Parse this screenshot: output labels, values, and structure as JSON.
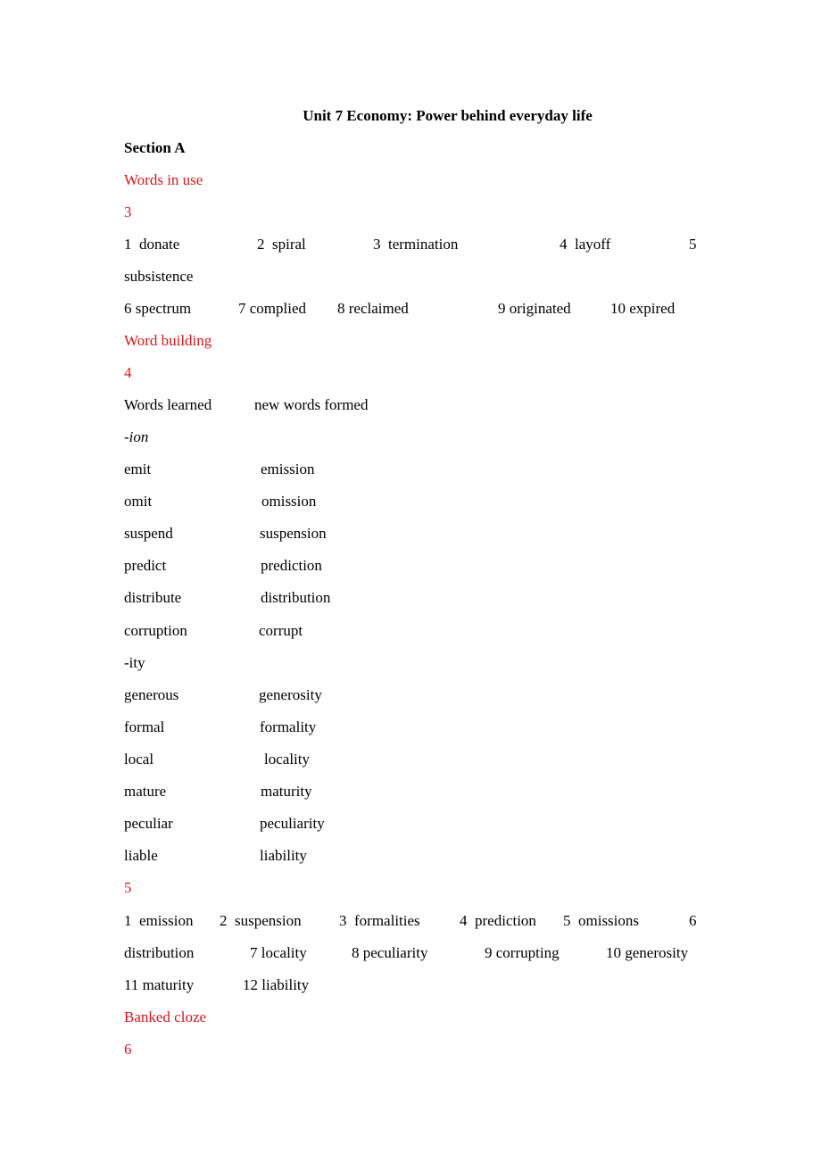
{
  "document": {
    "title": "Unit 7 Economy: Power behind everyday life",
    "section": "Section A",
    "words_in_use": {
      "heading": "Words in use",
      "exercise_number": "3",
      "answers_row1": [
        "1  donate",
        "2  spiral",
        "3  termination",
        "4  layoff",
        "5"
      ],
      "answers_row1_wrap": "subsistence",
      "answers_row2": [
        "6 spectrum",
        "7 complied",
        "8 reclaimed",
        "9 originated",
        "10 expired"
      ]
    },
    "word_building": {
      "heading": "Word building",
      "exercise_number": "4",
      "col_headers": [
        "Words learned",
        "new words formed"
      ],
      "groups": [
        {
          "suffix": "-ion",
          "pairs": [
            [
              "emit",
              "emission"
            ],
            [
              "omit",
              "omission"
            ],
            [
              "suspend",
              "suspension"
            ],
            [
              "predict",
              "prediction"
            ],
            [
              "distribute",
              "distribution"
            ],
            [
              "corruption",
              "corrupt"
            ]
          ]
        },
        {
          "suffix": "-ity",
          "pairs": [
            [
              "generous",
              "generosity"
            ],
            [
              "formal",
              "formality"
            ],
            [
              "local",
              "locality"
            ],
            [
              "mature",
              "maturity"
            ],
            [
              "peculiar",
              "peculiarity"
            ],
            [
              "liable",
              "liability"
            ]
          ]
        }
      ]
    },
    "exercise5": {
      "number": "5",
      "row1": [
        "1  emission",
        "2  suspension",
        "3  formalities",
        "4  prediction",
        "5  omissions",
        "6"
      ],
      "row2": [
        "distribution",
        "7 locality",
        "8 peculiarity",
        "9 corrupting",
        "10 generosity"
      ],
      "row3": [
        "11 maturity",
        "12 liability"
      ]
    },
    "banked_cloze": {
      "heading": "Banked cloze",
      "exercise_number": "6"
    }
  },
  "colors": {
    "heading_red": "#d9161c",
    "text": "#000000"
  }
}
